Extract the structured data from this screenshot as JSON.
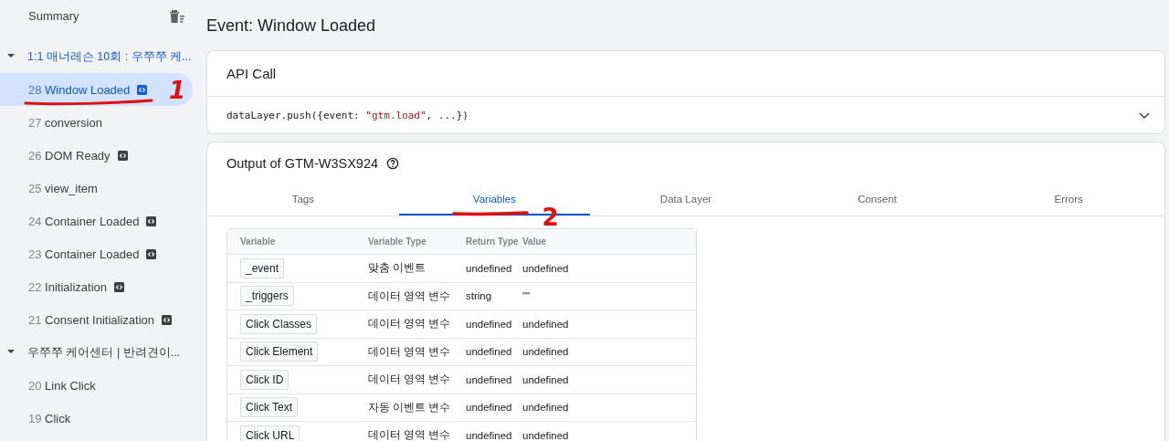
{
  "sidebar": {
    "summary": "Summary",
    "groups": [
      {
        "title": "1:1 매너레슨 10회 : 우쭈쭈 케...",
        "expanded": true,
        "active": true,
        "events": [
          {
            "number": "28",
            "name": "Window Loaded",
            "badge": true,
            "selected": true
          },
          {
            "number": "27",
            "name": "conversion",
            "badge": false,
            "selected": false
          },
          {
            "number": "26",
            "name": "DOM Ready",
            "badge": true,
            "selected": false
          },
          {
            "number": "25",
            "name": "view_item",
            "badge": false,
            "selected": false
          },
          {
            "number": "24",
            "name": "Container Loaded",
            "badge": true,
            "selected": false
          },
          {
            "number": "23",
            "name": "Container Loaded",
            "badge": true,
            "selected": false
          },
          {
            "number": "22",
            "name": "Initialization",
            "badge": true,
            "selected": false
          },
          {
            "number": "21",
            "name": "Consent Initialization",
            "badge": true,
            "selected": false
          }
        ]
      },
      {
        "title": "우쭈쭈 케어센터 | 반려견이...",
        "expanded": true,
        "active": false,
        "events": [
          {
            "number": "20",
            "name": "Link Click",
            "badge": false,
            "selected": false
          },
          {
            "number": "19",
            "name": "Click",
            "badge": false,
            "selected": false
          }
        ]
      }
    ]
  },
  "main": {
    "title": "Event: Window Loaded",
    "api_call": {
      "title": "API Call",
      "code": [
        {
          "kind": "plain",
          "text": "dataLayer.push({event: "
        },
        {
          "kind": "string",
          "text": "\"gtm.load\""
        },
        {
          "kind": "plain",
          "text": ", ...})"
        }
      ],
      "expanded": false
    },
    "output": {
      "title": "Output of GTM-W3SX924",
      "tabs": [
        {
          "label": "Tags",
          "selected": false
        },
        {
          "label": "Variables",
          "selected": true
        },
        {
          "label": "Data Layer",
          "selected": false
        },
        {
          "label": "Consent",
          "selected": false
        },
        {
          "label": "Errors",
          "selected": false
        }
      ],
      "table": {
        "columns": [
          "Variable",
          "Variable Type",
          "Return Type",
          "Value"
        ],
        "rows": [
          [
            "_event",
            "맞춤 이벤트",
            "undefined",
            "undefined"
          ],
          [
            "_triggers",
            "데이터 영역 변수",
            "string",
            "\"\""
          ],
          [
            "Click Classes",
            "데이터 영역 변수",
            "undefined",
            "undefined"
          ],
          [
            "Click Element",
            "데이터 영역 변수",
            "undefined",
            "undefined"
          ],
          [
            "Click ID",
            "데이터 영역 변수",
            "undefined",
            "undefined"
          ],
          [
            "Click Text",
            "자동 이벤트 변수",
            "undefined",
            "undefined"
          ],
          [
            "Click URL",
            "데이터 영역 변수",
            "undefined",
            "undefined"
          ]
        ]
      }
    }
  },
  "annotations": [
    {
      "text": "1"
    },
    {
      "text": "2"
    }
  ]
}
